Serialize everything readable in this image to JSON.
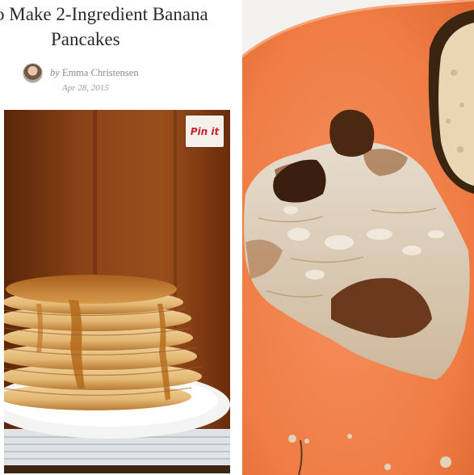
{
  "article": {
    "title_line1": "o Make 2-Ingredient Banana",
    "title_line2": "Pancakes",
    "byline_prefix": "by",
    "author": "Emma Christensen",
    "date": "Apr 28, 2015",
    "pin_button_label": "Pin it"
  },
  "colors": {
    "pin_red": "#c8232c",
    "plate_orange": "#f0824a",
    "wood_brown": "#7a3a14",
    "syrup_amber": "#b56a1c"
  }
}
